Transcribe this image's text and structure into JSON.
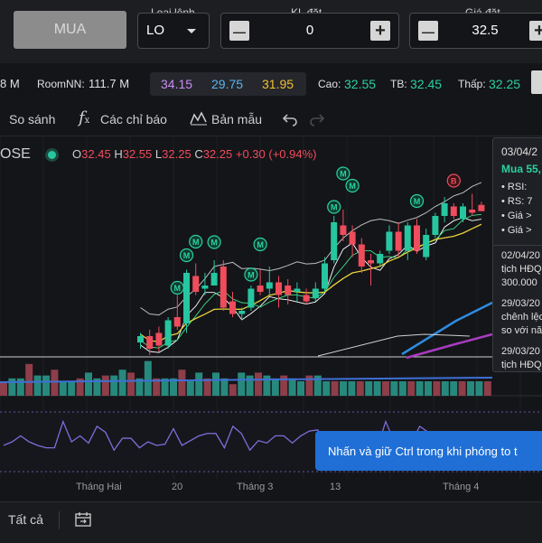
{
  "order": {
    "buy_label": "MUA",
    "order_type_label": "Loại lệnh",
    "order_type_value": "LO",
    "qty_label": "KL đặt",
    "qty_value": "0",
    "price_label": "Giá đặt",
    "price_value": "32.5",
    "minus": "—",
    "plus": "+"
  },
  "info": {
    "vol_fragment": "8 M",
    "room_label": "RoomNN:",
    "room_value": "111.7 M",
    "ceil": "34.15",
    "floor": "29.75",
    "ref": "31.95",
    "high_label": "Cao:",
    "high_value": "32.55",
    "avg_label": "TB:",
    "avg_value": "32.45",
    "low_label": "Thấp:",
    "low_value": "32.25"
  },
  "toolbar": {
    "compare": "So sánh",
    "indicators": "Các chỉ báo",
    "templates": "Bản mẫu"
  },
  "ohlc": {
    "exchange": "OSE",
    "o_label": "O",
    "o": "32.45",
    "h_label": "H",
    "h": "32.55",
    "l_label": "L",
    "l": "32.25",
    "c_label": "C",
    "c": "32.25",
    "change": "+0.30 (+0.94%)"
  },
  "markers": {
    "buy": "M",
    "sell": "B"
  },
  "tooltip": {
    "date": "03/04/2",
    "signal": "Mua 55,",
    "bullets": [
      "RSI:",
      "RS: 7",
      "Giá >",
      "Giá >"
    ],
    "note1_date": "02/04/20",
    "note1_line1": "tịch HĐQ",
    "note1_line2": "300.000",
    "note2_date": "29/03/20",
    "note2_line1": "chênh lệc",
    "note2_line2": "so với nă",
    "note3_date": "29/03/20",
    "note3_line1": "tịch HĐQ"
  },
  "toast": "Nhấn và giữ Ctrl trong khi phóng to t",
  "xaxis": [
    "Tháng Hai",
    "20",
    "Tháng 3",
    "13",
    "Tháng 4"
  ],
  "bottom": {
    "all_label": "Tất cả"
  },
  "colors": {
    "up": "#26c6a0",
    "down": "#ef4c5c",
    "accent": "#2bd1a0",
    "ceil": "#c98cf5",
    "floor": "#5ab4f0",
    "ref": "#f0c030",
    "toast": "#1f6fd6"
  },
  "chart_data": {
    "type": "candlestick",
    "candles": [
      {
        "o": 28.1,
        "h": 28.4,
        "l": 27.9,
        "c": 28.3
      },
      {
        "o": 28.3,
        "h": 28.5,
        "l": 27.7,
        "c": 27.9
      },
      {
        "o": 28.4,
        "h": 28.6,
        "l": 27.8,
        "c": 28.0
      },
      {
        "o": 28.0,
        "h": 28.9,
        "l": 27.9,
        "c": 28.8
      },
      {
        "o": 28.9,
        "h": 29.6,
        "l": 28.5,
        "c": 28.6
      },
      {
        "o": 28.7,
        "h": 30.4,
        "l": 28.4,
        "c": 30.3
      },
      {
        "o": 30.2,
        "h": 30.6,
        "l": 29.6,
        "c": 29.7
      },
      {
        "o": 29.8,
        "h": 30.3,
        "l": 29.6,
        "c": 29.9
      },
      {
        "o": 29.9,
        "h": 30.7,
        "l": 29.9,
        "c": 30.3
      },
      {
        "o": 30.5,
        "h": 30.7,
        "l": 29.1,
        "c": 29.2
      },
      {
        "o": 29.4,
        "h": 29.7,
        "l": 28.9,
        "c": 29.0
      },
      {
        "o": 29.0,
        "h": 29.2,
        "l": 28.8,
        "c": 29.1
      },
      {
        "o": 29.2,
        "h": 29.9,
        "l": 29.1,
        "c": 29.8
      },
      {
        "o": 29.9,
        "h": 30.4,
        "l": 29.6,
        "c": 29.7
      },
      {
        "o": 29.8,
        "h": 30.5,
        "l": 29.6,
        "c": 30.0
      },
      {
        "o": 30.0,
        "h": 30.2,
        "l": 29.2,
        "c": 29.6
      },
      {
        "o": 29.9,
        "h": 30.1,
        "l": 29.3,
        "c": 29.6
      },
      {
        "o": 29.7,
        "h": 30.0,
        "l": 29.4,
        "c": 29.8
      },
      {
        "o": 29.6,
        "h": 29.8,
        "l": 29.3,
        "c": 29.4
      },
      {
        "o": 29.5,
        "h": 30.0,
        "l": 29.4,
        "c": 29.8
      },
      {
        "o": 29.8,
        "h": 30.8,
        "l": 29.7,
        "c": 30.6
      },
      {
        "o": 30.7,
        "h": 32.1,
        "l": 30.6,
        "c": 31.9
      },
      {
        "o": 31.8,
        "h": 32.3,
        "l": 31.3,
        "c": 31.5
      },
      {
        "o": 31.6,
        "h": 31.8,
        "l": 30.8,
        "c": 31.2
      },
      {
        "o": 31.2,
        "h": 31.4,
        "l": 30.3,
        "c": 30.5
      },
      {
        "o": 30.7,
        "h": 30.9,
        "l": 29.9,
        "c": 30.6
      },
      {
        "o": 30.6,
        "h": 31.0,
        "l": 30.5,
        "c": 30.9
      },
      {
        "o": 31.0,
        "h": 31.8,
        "l": 30.9,
        "c": 31.6
      },
      {
        "o": 31.6,
        "h": 31.9,
        "l": 30.8,
        "c": 31.0
      },
      {
        "o": 31.0,
        "h": 31.9,
        "l": 30.7,
        "c": 31.8
      },
      {
        "o": 31.8,
        "h": 32.0,
        "l": 30.9,
        "c": 31.0
      },
      {
        "o": 30.8,
        "h": 31.7,
        "l": 30.7,
        "c": 31.5
      },
      {
        "o": 31.5,
        "h": 32.2,
        "l": 31.4,
        "c": 32.1
      },
      {
        "o": 32.1,
        "h": 32.7,
        "l": 31.9,
        "c": 32.5
      },
      {
        "o": 32.4,
        "h": 32.5,
        "l": 32.0,
        "c": 32.1
      },
      {
        "o": 32.0,
        "h": 32.5,
        "l": 31.9,
        "c": 32.4
      },
      {
        "o": 32.3,
        "h": 32.8,
        "l": 32.1,
        "c": 32.2
      },
      {
        "o": 32.45,
        "h": 32.55,
        "l": 32.25,
        "c": 32.25
      }
    ],
    "volume": [
      5,
      6,
      5,
      7,
      9,
      12,
      8,
      6,
      7,
      8,
      6,
      5,
      6,
      7,
      6,
      7,
      6,
      5,
      5,
      6,
      8,
      11,
      9,
      8,
      7,
      6,
      6,
      7,
      7,
      8,
      6,
      7,
      8,
      9,
      6,
      7,
      6,
      4
    ],
    "rsi": [
      52,
      48,
      50,
      55,
      58,
      68,
      60,
      58,
      62,
      55,
      50,
      48,
      52,
      55,
      56,
      50,
      52,
      54,
      50,
      53,
      60,
      72,
      66,
      60,
      55,
      52,
      54,
      60,
      56,
      60,
      54,
      60,
      64,
      68,
      62,
      65,
      63,
      62
    ]
  }
}
